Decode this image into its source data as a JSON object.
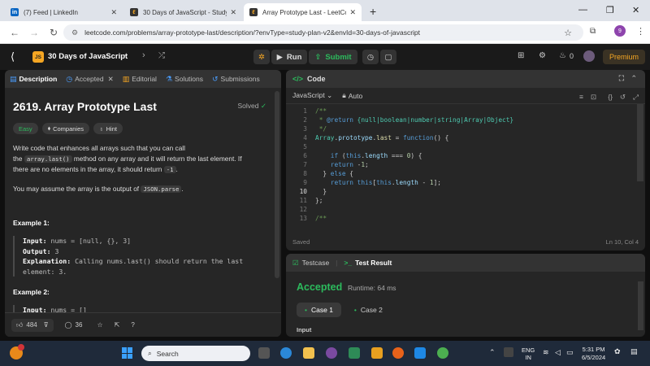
{
  "browser": {
    "tabs": [
      {
        "title": "(7) Feed | LinkedIn",
        "favicon": "in",
        "color": "#0a66c2"
      },
      {
        "title": "30 Days of JavaScript - Study Pl",
        "favicon": "",
        "color": "#f5a623"
      },
      {
        "title": "Array Prototype Last - LeetCod",
        "favicon": "",
        "color": "#f5a623"
      }
    ],
    "url": "leetcode.com/problems/array-prototype-last/description/?envType=study-plan-v2&envId=30-days-of-javascript",
    "avatar": "9"
  },
  "header": {
    "study_plan": "30 Days of JavaScript",
    "run": "Run",
    "submit": "Submit",
    "streak": "0",
    "premium": "Premium"
  },
  "problem": {
    "tabs": [
      "Description",
      "Accepted",
      "Editorial",
      "Solutions",
      "Submissions"
    ],
    "title": "2619. Array Prototype Last",
    "status": "Solved",
    "chips": [
      "Easy",
      "Companies",
      "Hint"
    ],
    "p1_a": "Write code that enhances all arrays such that you can call",
    "p1_b": "the",
    "p1_code": "array.last()",
    "p1_c": "method on any array and it will return the last element. If",
    "p1_d": "there are no elements in the array, it should return",
    "p1_code2": "-1",
    "p1_e": ".",
    "p2_a": "You may assume the array is the output of",
    "p2_code": "JSON.parse",
    "p2_b": ".",
    "ex1_title": "Example 1:",
    "ex1_input_label": "Input:",
    "ex1_input": "nums = [null, {}, 3]",
    "ex1_output_label": "Output:",
    "ex1_output": "3",
    "ex1_expl_label": "Explanation:",
    "ex1_expl_1": "Calling nums.last() should return the last",
    "ex1_expl_2": "element: 3.",
    "ex2_title": "Example 2:",
    "ex2_input_label": "Input:",
    "ex2_input": "nums = []",
    "likes": "484",
    "comments": "36"
  },
  "editor": {
    "title": "Code",
    "language": "JavaScript",
    "mode": "Auto",
    "saved": "Saved",
    "cursor": "Ln 10, Col 4"
  },
  "test": {
    "tab1": "Testcase",
    "tab2": "Test Result",
    "verdict": "Accepted",
    "runtime": "Runtime: 64 ms",
    "case1": "Case 1",
    "case2": "Case 2",
    "input_label": "Input"
  },
  "taskbar": {
    "search": "Search",
    "lang1": "ENG",
    "lang2": "IN",
    "time": "5:31 PM",
    "date": "6/5/2024"
  }
}
